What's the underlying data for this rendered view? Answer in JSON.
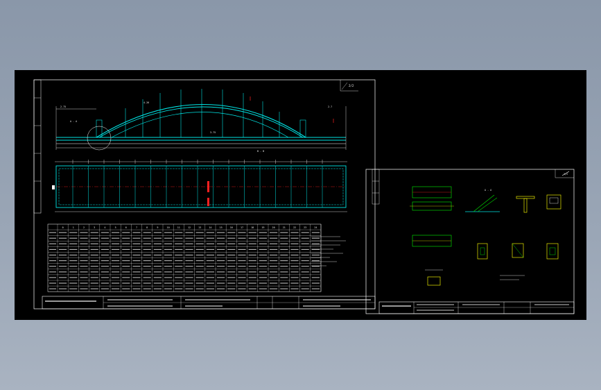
{
  "sheet1": {
    "corner_mark": "2/2",
    "dimension_label": "4.26",
    "span_label": "3.75",
    "section_A": "A - A",
    "section_B": "B - B",
    "dim_upper_left": "2.75",
    "dim_upper_right": "2.7",
    "table": {
      "header": [
        "0",
        "1",
        "2",
        "3",
        "4",
        "5",
        "6",
        "7",
        "8",
        "9",
        "10",
        "11",
        "12",
        "13",
        "14",
        "15",
        "16",
        "17",
        "18",
        "19",
        "20",
        "21",
        "22",
        "23",
        "24"
      ]
    }
  },
  "sheet2": {
    "corner_mark": "2/2",
    "section_A": "A - A"
  },
  "colors": {
    "background": "#000000",
    "frame": "#ffffff",
    "arch": "#00e5e5",
    "red": "#ff2020",
    "yellow": "#e8e800",
    "green": "#00d000"
  }
}
